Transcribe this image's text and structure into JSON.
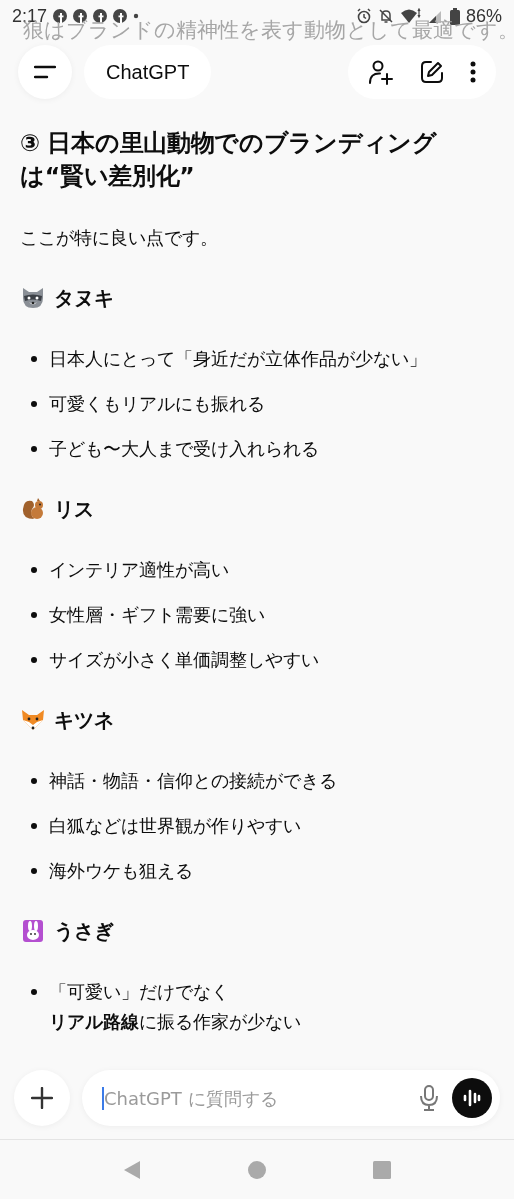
{
  "status_bar": {
    "time": "2:17",
    "notification_icons": [
      {
        "kind": "app"
      },
      {
        "kind": "app"
      },
      {
        "kind": "app"
      },
      {
        "kind": "app"
      },
      {
        "kind": "more"
      }
    ],
    "battery": "86%"
  },
  "scrolled_text": "狼はブランドの精神性を表す動物として最適です。",
  "header": {
    "title": "ChatGPT"
  },
  "message": {
    "heading": "③ 日本の里山動物でのブランディングは“賢い差別化”",
    "intro": "ここが特に良い点です。",
    "sections": [
      {
        "kind": "raccoon",
        "title": "タヌキ",
        "bullets": [
          "日本人にとって「身近だが立体作品が少ない」",
          "可愛くもリアルにも振れる",
          "子ども〜大人まで受け入れられる"
        ]
      },
      {
        "kind": "squirrel",
        "title": "リス",
        "bullets": [
          "インテリア適性が高い",
          "女性層・ギフト需要に強い",
          "サイズが小さく単価調整しやすい"
        ]
      },
      {
        "kind": "fox",
        "title": "キツネ",
        "bullets": [
          "神話・物語・信仰との接続ができる",
          "白狐などは世界観が作りやすい",
          "海外ウケも狙える"
        ]
      },
      {
        "kind": "rabbit",
        "title": "うさぎ",
        "bullets": [
          [
            "「可愛い」だけでなく",
            "**リアル路線**に振る作家が少ない"
          ]
        ]
      }
    ]
  },
  "composer": {
    "placeholder": "ChatGPT に質問する"
  }
}
